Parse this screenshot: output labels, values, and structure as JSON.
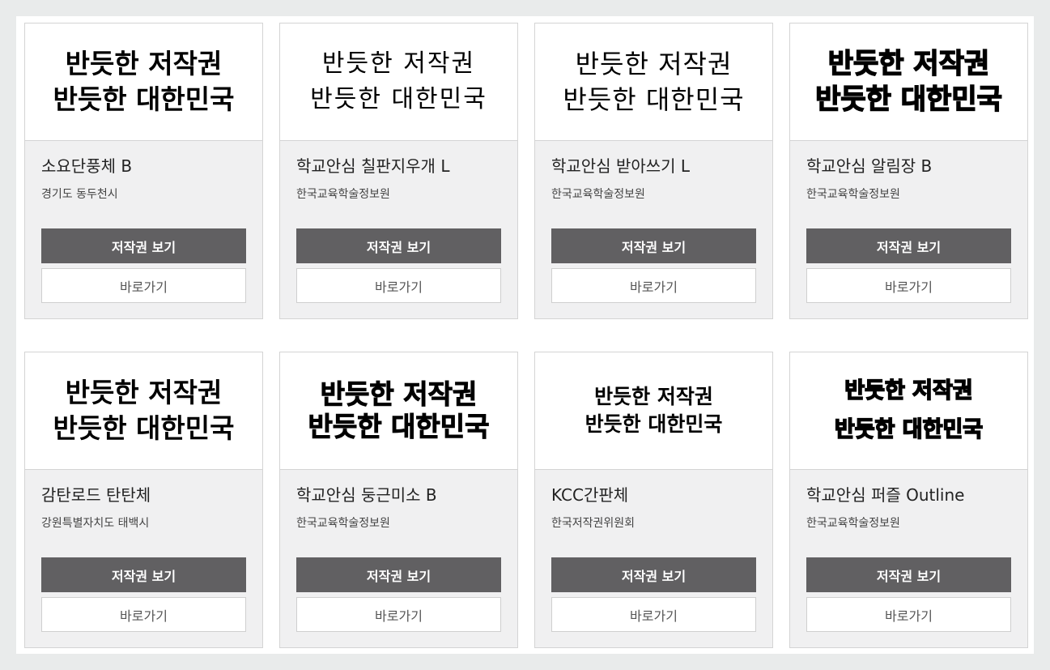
{
  "cards": [
    {
      "preview_line1": "반듯한 저작권",
      "preview_line2": "반듯한 대한민국",
      "font_name": "소요단풍체 B",
      "publisher": "경기도 동두천시",
      "license_label": "저작권 보기",
      "go_label": "바로가기"
    },
    {
      "preview_line1": "반듯한 저작권",
      "preview_line2": "반듯한 대한민국",
      "font_name": "학교안심 칠판지우개 L",
      "publisher": "한국교육학술정보원",
      "license_label": "저작권 보기",
      "go_label": "바로가기"
    },
    {
      "preview_line1": "반듯한 저작권",
      "preview_line2": "반듯한 대한민국",
      "font_name": "학교안심 받아쓰기 L",
      "publisher": "한국교육학술정보원",
      "license_label": "저작권 보기",
      "go_label": "바로가기"
    },
    {
      "preview_line1": "반듯한 저작권",
      "preview_line2": "반듯한 대한민국",
      "font_name": "학교안심 알림장 B",
      "publisher": "한국교육학술정보원",
      "license_label": "저작권 보기",
      "go_label": "바로가기"
    },
    {
      "preview_line1": "반듯한 저작권",
      "preview_line2": "반듯한 대한민국",
      "font_name": "감탄로드 탄탄체",
      "publisher": "강원특별자치도 태백시",
      "license_label": "저작권 보기",
      "go_label": "바로가기"
    },
    {
      "preview_line1": "반듯한 저작권",
      "preview_line2": "반듯한 대한민국",
      "font_name": "학교안심 둥근미소 B",
      "publisher": "한국교육학술정보원",
      "license_label": "저작권 보기",
      "go_label": "바로가기"
    },
    {
      "preview_line1": "반듯한 저작권",
      "preview_line2": "반듯한 대한민국",
      "font_name": "KCC간판체",
      "publisher": "한국저작권위원회",
      "license_label": "저작권 보기",
      "go_label": "바로가기"
    },
    {
      "preview_line1": "반듯한 저작권",
      "preview_line2": "반듯한 대한민국",
      "font_name": "학교안심 퍼즐 Outline",
      "publisher": "한국교육학술정보원",
      "license_label": "저작권 보기",
      "go_label": "바로가기"
    }
  ]
}
